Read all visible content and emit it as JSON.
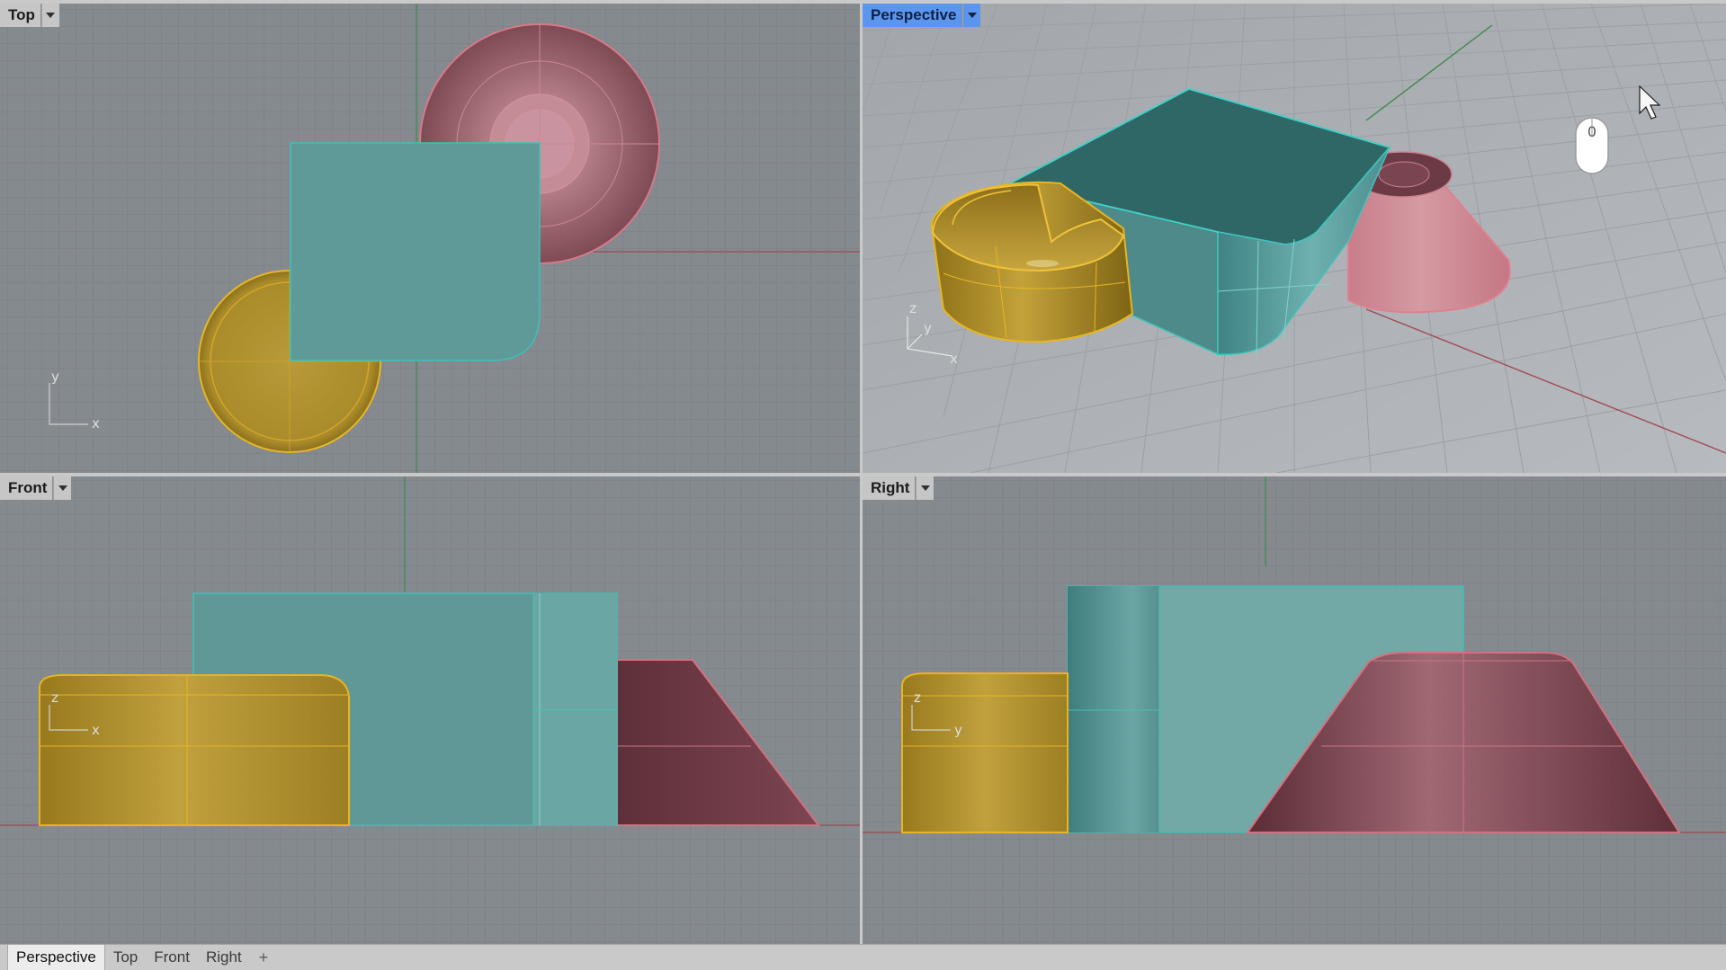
{
  "viewports": {
    "top": {
      "title": "Top",
      "axis_x": "x",
      "axis_y": "y"
    },
    "perspective": {
      "title": "Perspective",
      "axis_x": "x",
      "axis_y": "y",
      "axis_z": "z",
      "mouse_badge": "0"
    },
    "front": {
      "title": "Front",
      "axis_x": "x",
      "axis_y": "z"
    },
    "right": {
      "title": "Right",
      "axis_x": "y",
      "axis_y": "z"
    }
  },
  "tabs": [
    {
      "label": "Perspective",
      "active": true
    },
    {
      "label": "Top",
      "active": false
    },
    {
      "label": "Front",
      "active": false
    },
    {
      "label": "Right",
      "active": false
    }
  ],
  "add_tab_icon": "plus-icon",
  "colors": {
    "viewport_bg": "#858a8f",
    "teal_object": "#5f9a98",
    "gold_object": "#b3962f",
    "pink_object": "#b06673",
    "active_label": "#5b96ee"
  }
}
